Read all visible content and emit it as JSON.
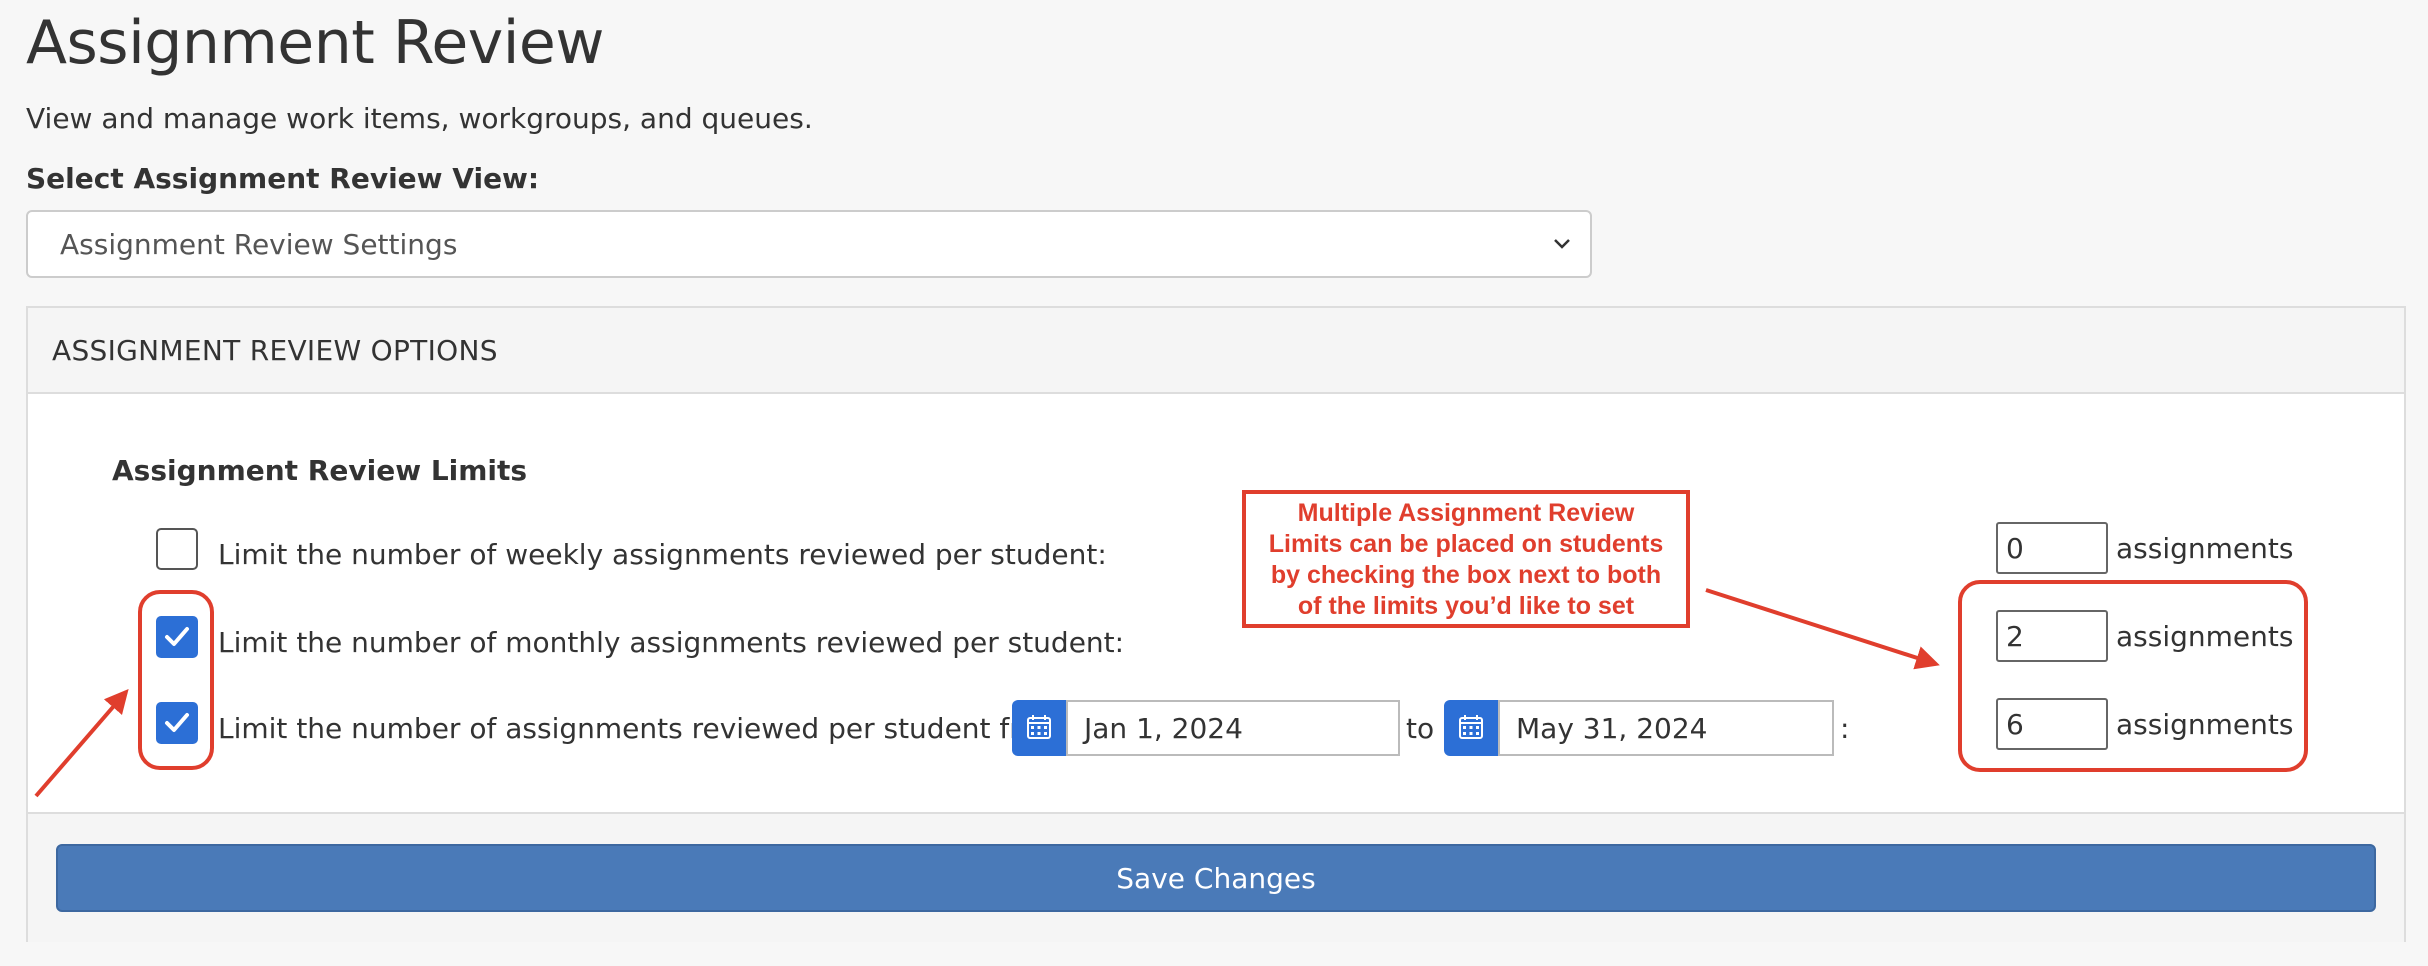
{
  "header": {
    "title": "Assignment Review",
    "subtitle": "View and manage work items, workgroups, and queues."
  },
  "view_selector": {
    "label": "Select Assignment Review View:",
    "selected": "Assignment Review Settings"
  },
  "panel": {
    "title": "ASSIGNMENT REVIEW OPTIONS",
    "section_heading": "Assignment Review Limits",
    "rows": [
      {
        "label": "Limit the number of weekly assignments reviewed per student:",
        "checked": false,
        "value": "0",
        "unit": "assignments"
      },
      {
        "label": "Limit the number of monthly assignments reviewed per student:",
        "checked": true,
        "value": "2",
        "unit": "assignments"
      },
      {
        "label": "Limit the number of assignments reviewed per student from",
        "checked": true,
        "value": "6",
        "unit": "assignments",
        "start_date": "Jan 1, 2024",
        "to_text": "to",
        "end_date": "May 31, 2024",
        "colon": ":"
      }
    ],
    "save_label": "Save Changes"
  },
  "annotation": {
    "lines": [
      "Multiple Assignment Review",
      "Limits can be placed on students",
      "by checking the box next to both",
      "of the limits you’d like to set"
    ],
    "color": "#e03e2d"
  },
  "colors": {
    "accent": "#2c6fd6",
    "button": "#4a7ab8",
    "annotation": "#e03e2d"
  }
}
